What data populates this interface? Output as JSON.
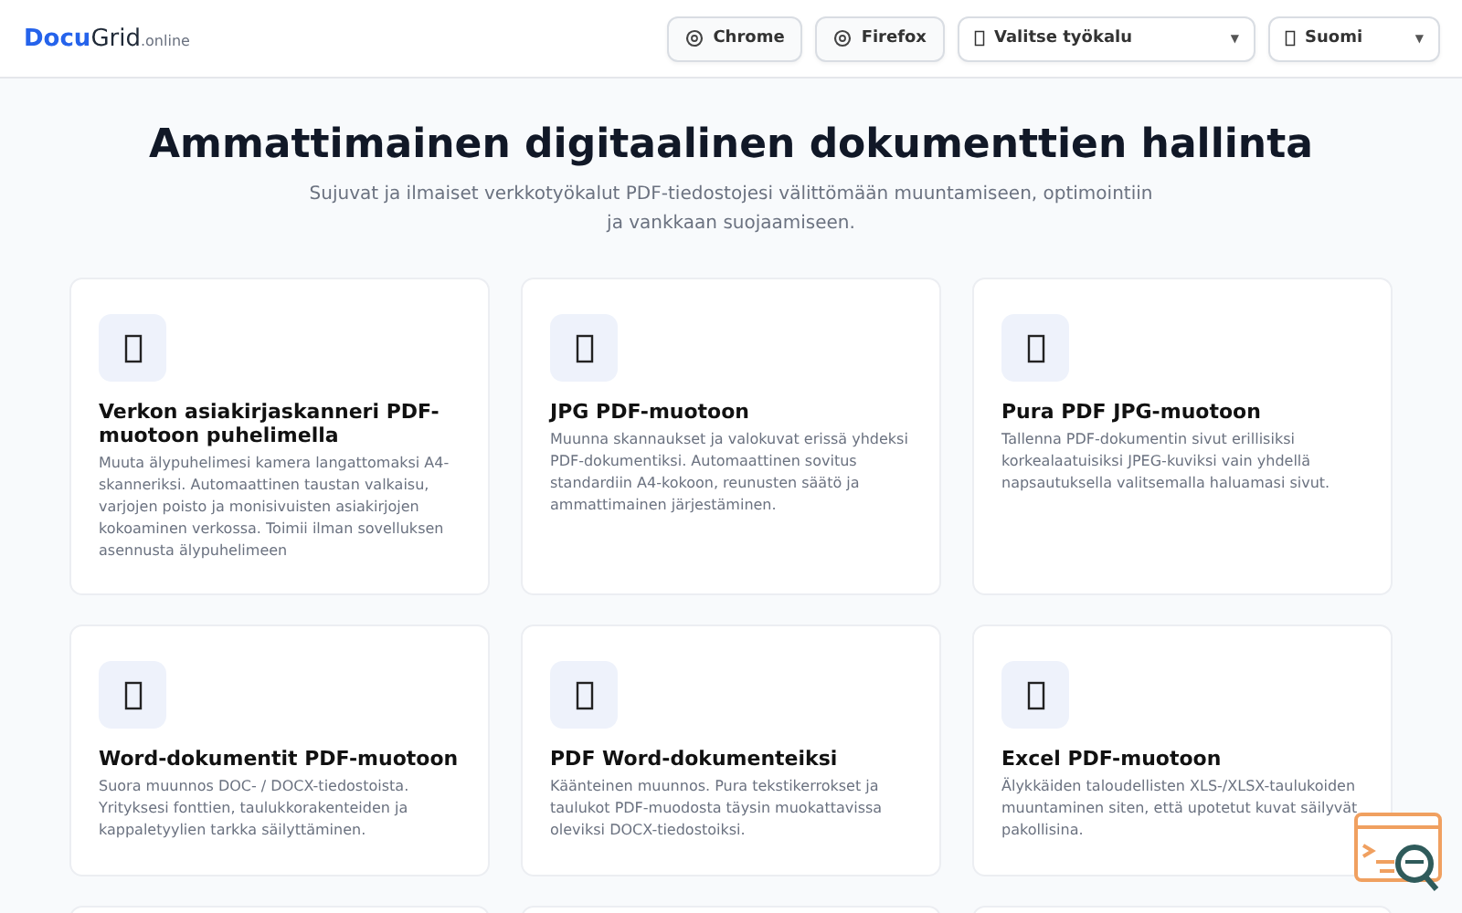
{
  "header": {
    "logo": {
      "primary": "Docu",
      "secondary": "Grid",
      "suffix": ".online"
    },
    "browser_buttons": [
      {
        "label": "Chrome"
      },
      {
        "label": "Firefox"
      }
    ],
    "selects": [
      {
        "value": "Valitse työkalu",
        "caret": "▼"
      },
      {
        "value": "Suomi",
        "caret": "▼"
      }
    ]
  },
  "hero": {
    "title": "Ammattimainen digitaalinen dokumenttien hallinta",
    "subtitle": "Sujuvat ja ilmaiset verkkotyökalut PDF-tiedostojesi välittömään muuntamiseen, optimointiin ja vankkaan suojaamiseen."
  },
  "tools": [
    {
      "title": "Verkon asiakirjaskanneri PDF-muotoon puhelimella",
      "description": "Muuta älypuhelimesi kamera langattomaksi A4-skanneriksi. Automaattinen taustan valkaisu, varjojen poisto ja monisivuisten asiakirjojen kokoaminen verkossa. Toimii ilman sovelluksen asennusta älypuhelimeen"
    },
    {
      "title": "JPG PDF-muotoon",
      "description": "Muunna skannaukset ja valokuvat erissä yhdeksi PDF-dokumentiksi. Automaattinen sovitus standardiin A4-kokoon, reunusten säätö ja ammattimainen järjestäminen."
    },
    {
      "title": "Pura PDF JPG-muotoon",
      "description": "Tallenna PDF-dokumentin sivut erillisiksi korkealaatuisiksi JPEG-kuviksi vain yhdellä napsautuksella valitsemalla haluamasi sivut."
    },
    {
      "title": "Word-dokumentit PDF-muotoon",
      "description": "Suora muunnos DOC- / DOCX-tiedostoista. Yrityksesi fonttien, taulukkorakenteiden ja kappaletyylien tarkka säilyttäminen."
    },
    {
      "title": "PDF Word-dokumenteiksi",
      "description": "Käänteinen muunnos. Pura tekstikerrokset ja taulukot PDF-muodosta täysin muokattavissa oleviksi DOCX-tiedostoiksi."
    },
    {
      "title": "Excel PDF-muotoon",
      "description": "Älykkäiden taloudellisten XLS-/XLSX-taulukoiden muuntaminen siten, että upotetut kuvat säilyvät pakollisina."
    }
  ]
}
